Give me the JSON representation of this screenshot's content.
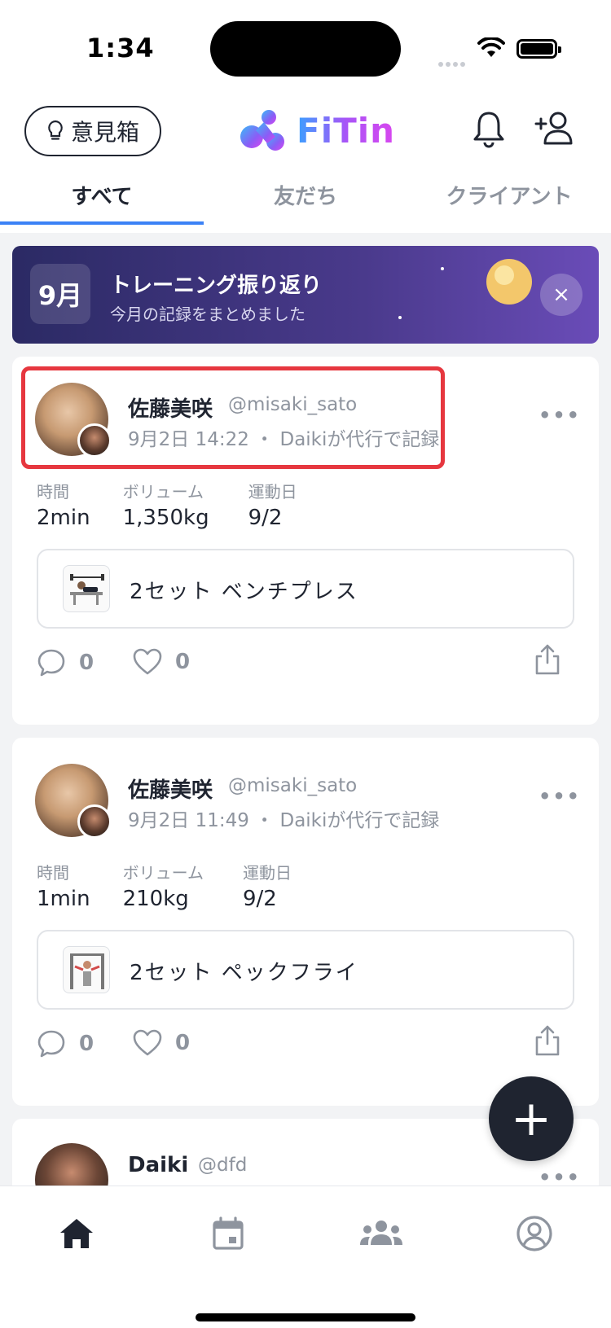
{
  "status_bar": {
    "time": "1:34"
  },
  "header": {
    "feedback_label": "意見箱",
    "logo_text": "FiTin"
  },
  "tabs": [
    {
      "label": "すべて",
      "active": true
    },
    {
      "label": "友だち",
      "active": false
    },
    {
      "label": "クライアント",
      "active": false
    }
  ],
  "banner": {
    "month": "9月",
    "title": "トレーニング振り返り",
    "subtitle": "今月の記録をまとめました",
    "close": "×"
  },
  "posts": [
    {
      "name": "佐藤美咲",
      "handle": "@misaki_sato",
      "meta": "9月2日 14:22 ・ Daikiが代行で記録",
      "stats": [
        {
          "label": "時間",
          "value": "2min"
        },
        {
          "label": "ボリューム",
          "value": "1,350kg"
        },
        {
          "label": "運動日",
          "value": "9/2"
        }
      ],
      "exercise": "2セット  ベンチプレス",
      "comments": "0",
      "likes": "0"
    },
    {
      "name": "佐藤美咲",
      "handle": "@misaki_sato",
      "meta": "9月2日 11:49 ・ Daikiが代行で記録",
      "stats": [
        {
          "label": "時間",
          "value": "1min"
        },
        {
          "label": "ボリューム",
          "value": "210kg"
        },
        {
          "label": "運動日",
          "value": "9/2"
        }
      ],
      "exercise": "2セット  ペックフライ",
      "comments": "0",
      "likes": "0"
    },
    {
      "name": "Daiki",
      "handle": "@dfd"
    }
  ],
  "more_icon": "•••",
  "fab_label": "+"
}
